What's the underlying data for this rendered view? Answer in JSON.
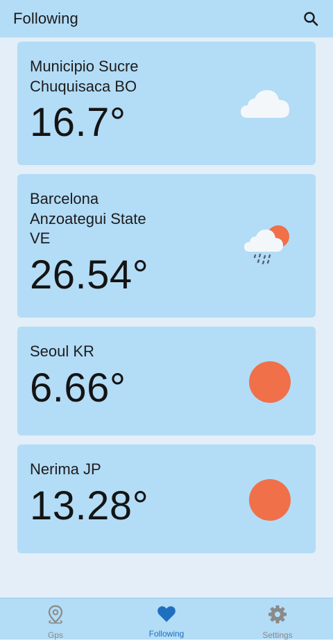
{
  "appbar": {
    "title": "Following"
  },
  "cards": [
    {
      "place": "Municipio Sucre\nChuquisaca BO",
      "temp": "16.7°",
      "icon": "cloud-icon"
    },
    {
      "place": "Barcelona\nAnzoategui State\nVE",
      "temp": "26.54°",
      "icon": "sun-cloud-rain-icon"
    },
    {
      "place": "Seoul KR",
      "temp": "6.66°",
      "icon": "sun-icon"
    },
    {
      "place": "Nerima JP",
      "temp": "13.28°",
      "icon": "sun-icon"
    }
  ],
  "bottom_nav": [
    {
      "label": "Gps",
      "icon": "location-pin-icon"
    },
    {
      "label": "Following",
      "icon": "heart-icon",
      "active": true
    },
    {
      "label": "Settings",
      "icon": "gear-icon"
    }
  ],
  "colors": {
    "bar": "#b3dcf6",
    "background": "#e3eef8",
    "sun": "#f0704a",
    "active": "#1f6fbf"
  }
}
